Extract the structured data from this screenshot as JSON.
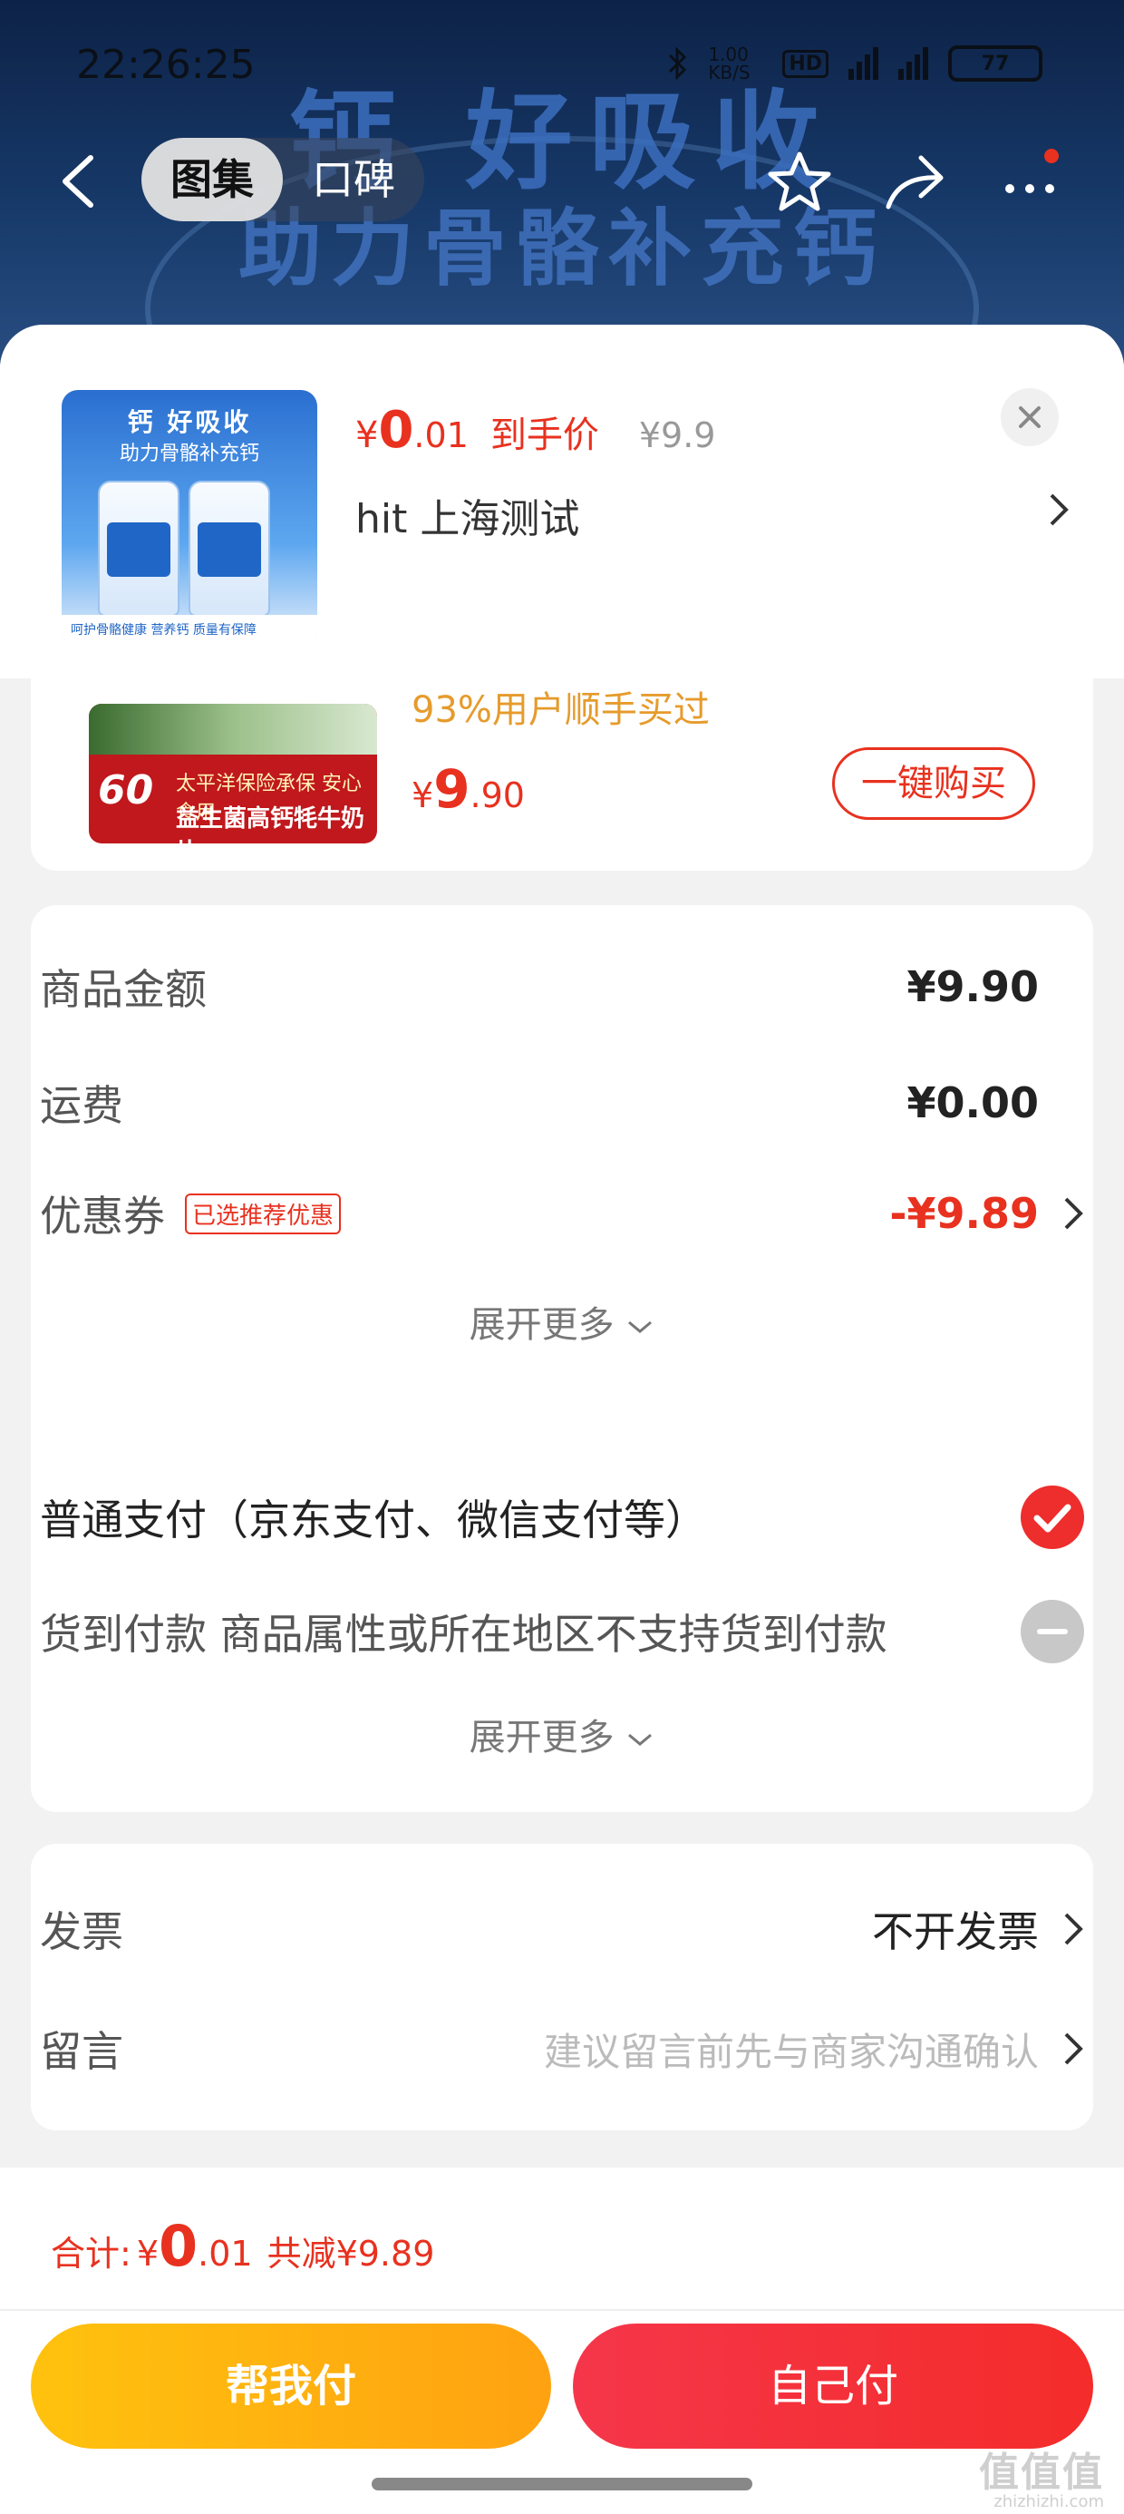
{
  "status_bar": {
    "time": "22:26:25",
    "net_speed": "1.00 KB/S",
    "hd": "HD",
    "signal1": "5G",
    "signal2": "5G",
    "battery": "77"
  },
  "hero": {
    "line1": "钙 好吸收",
    "line2": "助力骨骼补充钙"
  },
  "nav": {
    "tabs": [
      "图集",
      "口碑"
    ],
    "active_tab": 0,
    "has_notification_dot": true
  },
  "product": {
    "thumb_title": "钙 好吸收",
    "thumb_subtitle": "助力骨骼补充钙",
    "thumb_footer": "呵护骨骼健康  营养钙  质量有保障",
    "price_symbol": "¥",
    "price_int": "0",
    "price_dec": ".01",
    "price_label": "到手价",
    "original_price": "¥9.9",
    "shop": "hit  上海测试"
  },
  "recommend": {
    "count_label": "60",
    "img_line1": "太平洋保险承保  安心食用",
    "img_line2": "益生菌高钙牦牛奶片",
    "note": "93%用户顺手买过",
    "price_symbol": "¥",
    "price_int": "9",
    "price_dec": ".90",
    "buy_label": "一键购买"
  },
  "amounts": {
    "goods_label": "商品金额",
    "goods_value": "¥9.90",
    "shipping_label": "运费",
    "shipping_value": "¥0.00",
    "coupon_label": "优惠券",
    "coupon_tag": "已选推荐优惠",
    "coupon_value": "-¥9.89",
    "expand_label": "展开更多"
  },
  "payment": {
    "normal_label": "普通支付（京东支付、微信支付等）",
    "normal_selected": true,
    "cod_label": "货到付款 商品属性或所在地区不支持货到付款",
    "cod_disabled": true,
    "expand_label": "展开更多"
  },
  "misc": {
    "invoice_label": "发票",
    "invoice_value": "不开发票",
    "message_label": "留言",
    "message_placeholder": "建议留言前先与商家沟通确认"
  },
  "footer": {
    "total_label": "合计:",
    "total_symbol": "¥",
    "total_int": "0",
    "total_dec": ".01",
    "saved": "共减¥9.89",
    "help_pay_label": "帮我付",
    "self_pay_label": "自己付",
    "watermark": "值值值",
    "watermark_sub": "zhizhizhi.com"
  },
  "colors": {
    "accent_red": "#e8311f",
    "pay_red": "#f42c2a",
    "help_yellow": "#ffb20f",
    "recommend_note": "#e69b2c"
  }
}
